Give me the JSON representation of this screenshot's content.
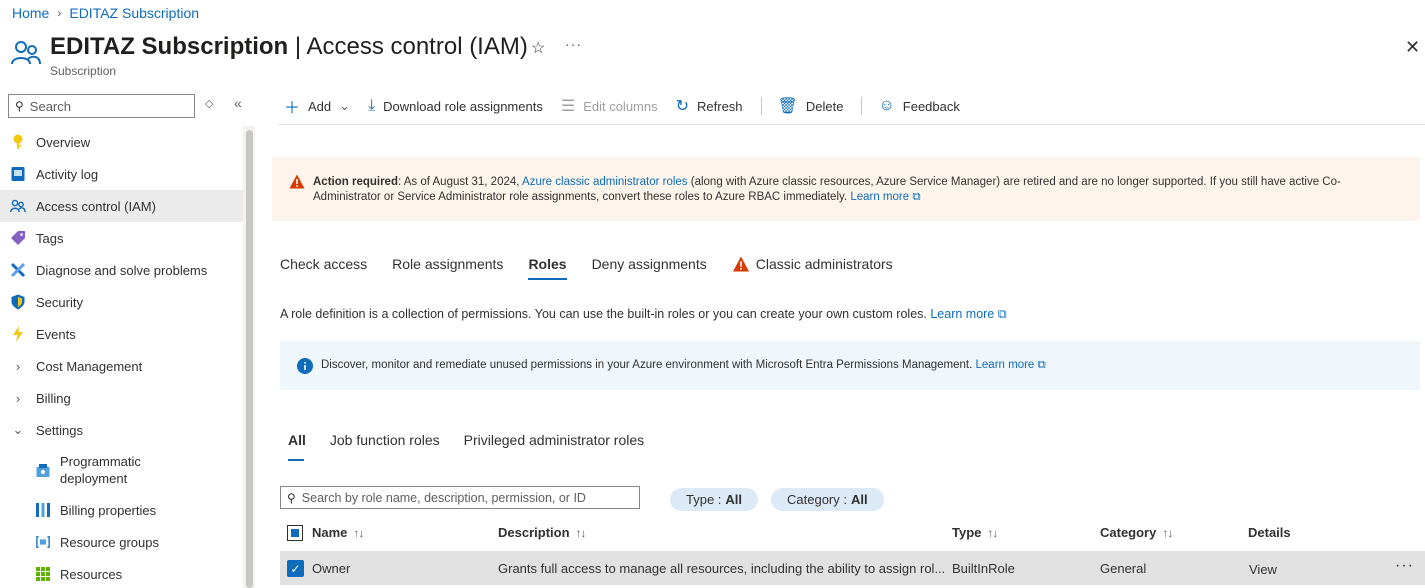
{
  "breadcrumb": {
    "home": "Home",
    "current": "EDITAZ Subscription"
  },
  "header": {
    "title_bold": "EDITAZ Subscription",
    "title_rest": " | Access control (IAM)",
    "subtitle": "Subscription",
    "star_icon": "☆",
    "more_icon": "···",
    "close_icon": "✕"
  },
  "sidebar": {
    "search_placeholder": "Search",
    "items": [
      {
        "label": "Overview",
        "icon": "key-icon"
      },
      {
        "label": "Activity log",
        "icon": "log-icon"
      },
      {
        "label": "Access control (IAM)",
        "icon": "people-icon",
        "active": true
      },
      {
        "label": "Tags",
        "icon": "tag-icon"
      },
      {
        "label": "Diagnose and solve problems",
        "icon": "wrench-icon"
      },
      {
        "label": "Security",
        "icon": "shield-icon"
      },
      {
        "label": "Events",
        "icon": "lightning-icon"
      },
      {
        "label": "Cost Management",
        "icon": "chevron-right-icon"
      },
      {
        "label": "Billing",
        "icon": "chevron-right-icon"
      },
      {
        "label": "Settings",
        "icon": "chevron-down-icon"
      }
    ],
    "sub_items": [
      {
        "label": "Programmatic deployment",
        "line1": "Programmatic",
        "line2": "deployment"
      },
      {
        "label": "Billing properties"
      },
      {
        "label": "Resource groups"
      },
      {
        "label": "Resources"
      }
    ]
  },
  "toolbar": {
    "add": "Add",
    "download": "Download role assignments",
    "edit_columns": "Edit columns",
    "refresh": "Refresh",
    "delete": "Delete",
    "feedback": "Feedback"
  },
  "warning": {
    "bold": "Action required",
    "text1": ": As of August 31, 2024, ",
    "link1": "Azure classic administrator roles",
    "text2": " (along with Azure classic resources, Azure Service Manager) are retired and are no longer supported. If you still have active Co-Administrator or Service Administrator role assignments, convert these roles to Azure RBAC immediately. ",
    "link2": "Learn more"
  },
  "tabs": [
    {
      "label": "Check access"
    },
    {
      "label": "Role assignments"
    },
    {
      "label": "Roles",
      "active": true
    },
    {
      "label": "Deny assignments"
    },
    {
      "label": "Classic administrators",
      "warning": true
    }
  ],
  "description": {
    "text": "A role definition is a collection of permissions. You can use the built-in roles or you can create your own custom roles. ",
    "link": "Learn more"
  },
  "info": {
    "text": "Discover, monitor and remediate unused permissions in your Azure environment with Microsoft Entra Permissions Management. ",
    "link": "Learn more"
  },
  "subtabs": [
    {
      "label": "All",
      "active": true
    },
    {
      "label": "Job function roles"
    },
    {
      "label": "Privileged administrator roles"
    }
  ],
  "filters": {
    "search_placeholder": "Search by role name, description, permission, or ID",
    "type_label": "Type :",
    "type_value": "All",
    "category_label": "Category :",
    "category_value": "All"
  },
  "table": {
    "columns": {
      "name": "Name",
      "description": "Description",
      "type": "Type",
      "category": "Category",
      "details": "Details"
    },
    "sort_icon": "↑↓",
    "rows": [
      {
        "name": "Owner",
        "description": "Grants full access to manage all resources, including the ability to assign rol...",
        "type": "BuiltInRole",
        "category": "General",
        "details": "View",
        "selected": true
      }
    ]
  },
  "colors": {
    "accent": "#0f6cbd",
    "warning": "#d83b01",
    "warning_bg": "#fdf5ec",
    "info_bg": "#eff6fc"
  }
}
